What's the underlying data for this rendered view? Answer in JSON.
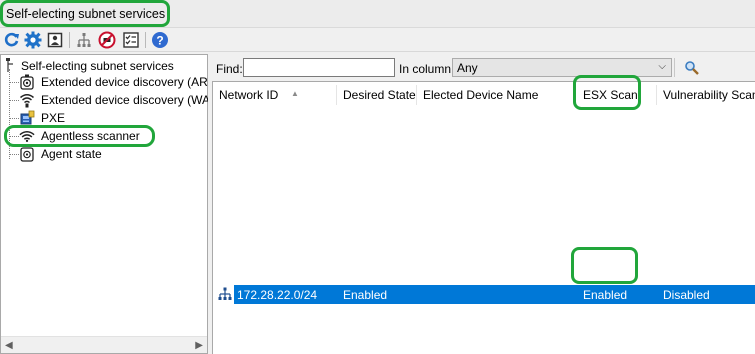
{
  "window": {
    "title": "Self-electing subnet services"
  },
  "toolbar": {
    "buttons": [
      "refresh-icon",
      "settings-gear-icon",
      "contact-card-icon",
      "network-tree-icon",
      "no-entry-icon",
      "checklist-icon",
      "help-icon"
    ]
  },
  "tree": {
    "root": "Self-electing subnet services",
    "items": [
      {
        "label": "Extended device discovery (ARP)",
        "icon": "arp-device-icon"
      },
      {
        "label": "Extended device discovery (WAP)",
        "icon": "wireless-icon"
      },
      {
        "label": "PXE",
        "icon": "pxe-computer-icon"
      },
      {
        "label": "Agentless scanner",
        "icon": "wifi-scanner-icon"
      },
      {
        "label": "Agent state",
        "icon": "agent-device-icon"
      }
    ]
  },
  "filter": {
    "find_label": "Find:",
    "find_value": "",
    "column_label": "In column:",
    "column_value": "Any"
  },
  "table": {
    "columns": [
      "Network ID",
      "Desired State",
      "Elected Device Name",
      "ESX Scan",
      "Vulnerability Scan"
    ],
    "rows": [
      {
        "network_id": "172.28.22.0/24",
        "desired_state": "Enabled",
        "elected_device_name": "",
        "esx_scan": "Enabled",
        "vulnerability_scan": "Disabled"
      }
    ]
  },
  "colors": {
    "highlight_green": "#21a63b",
    "selection_blue": "#0078d7"
  }
}
